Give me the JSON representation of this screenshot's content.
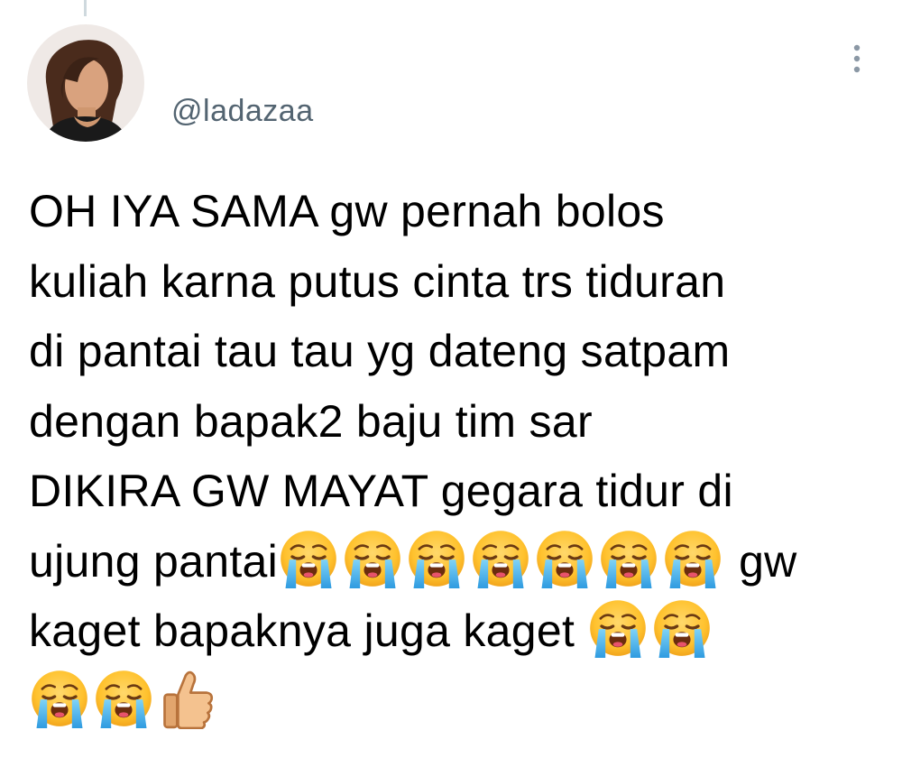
{
  "tweet": {
    "username": "@ladazaa",
    "lines": [
      "OH IYA SAMA gw pernah bolos",
      "kuliah karna putus cinta trs tiduran",
      "di pantai tau tau yg dateng satpam",
      "dengan bapak2 baju tim sar",
      "DIKIRA GW MAYAT gegara tidur di",
      "ujung pantai",
      "gw",
      "kaget bapaknya juga kaget"
    ],
    "emoji": {
      "crying": "loudly-crying-face",
      "thumbs": "thumbs-up"
    }
  }
}
